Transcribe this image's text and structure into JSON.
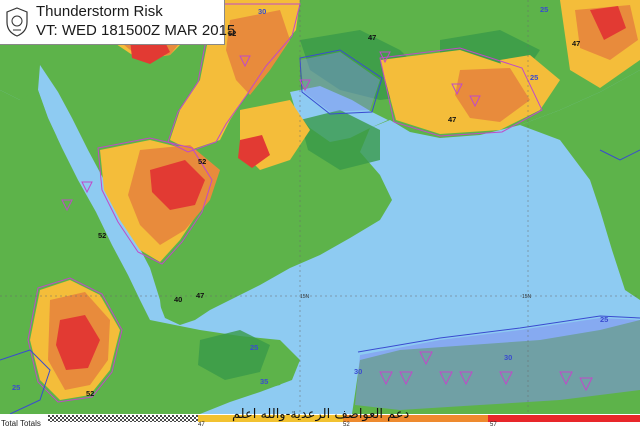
{
  "header": {
    "title": "Thunderstorm Risk",
    "valid_time": "VT: WED 181500Z MAR 2015"
  },
  "legend": {
    "label": "Total Totals",
    "ticks": [
      "47",
      "52",
      "57"
    ],
    "colors": {
      "below": "#4a4a4a",
      "band1": "#f2c230",
      "band2": "#ee8a2e",
      "band3": "#e8262a"
    }
  },
  "watermark": {
    "text": "دعم العواصف الرعدية-والله اعلم"
  },
  "map": {
    "colors": {
      "sea": "#8ecbf2",
      "land": "#5db34a",
      "tt47": "#f4bd3a",
      "tt52": "#e88b3c",
      "tt57": "#e23a33",
      "contour_pink": "#c04ac8",
      "contour_blue": "#3a4bd0",
      "green_dark": "#3a9a48"
    },
    "contour_labels": [
      {
        "text": "30",
        "color": "blue"
      },
      {
        "text": "47",
        "color": "black"
      },
      {
        "text": "52",
        "color": "black"
      },
      {
        "text": "25",
        "color": "blue"
      },
      {
        "text": "35",
        "color": "blue"
      },
      {
        "text": "40",
        "color": "black"
      }
    ],
    "gridline_labels": [
      "15N",
      "15N"
    ]
  }
}
